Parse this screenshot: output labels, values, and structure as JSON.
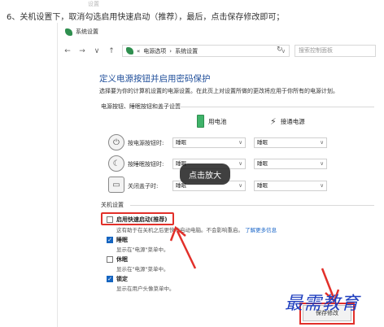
{
  "caption": "6、关机设置下，取消勾选启用快速启动（推荐），最后，点击保存修改即可；",
  "top_crop_text": "设置",
  "window": {
    "title": "系统设置",
    "nav": {
      "back": "←",
      "forward": "→",
      "down": "∨",
      "up": "↑"
    },
    "breadcrumb": [
      "电源选项",
      "系统设置"
    ],
    "breadcrumb_sep": "›",
    "breadcrumb_prefix": "«",
    "refresh": "↻",
    "search_placeholder": "搜索控制面板"
  },
  "heading": "定义电源按钮并启用密码保护",
  "subheading": "选择要为你的计算机设置的电源设置。在此页上对设置所做的更改将应用于你所有的电源计划。",
  "power_section": {
    "label": "电源按钮、睡眠按钮和盖子设置",
    "col_battery": "用电池",
    "col_plugged": "接通电源",
    "rows": [
      {
        "label": "按电源按钮时:",
        "battery": "睡眠",
        "plugged": "睡眠"
      },
      {
        "label": "按睡眠按钮时:",
        "battery": "睡眠",
        "plugged": "睡眠"
      },
      {
        "label": "关闭盖子时:",
        "battery": "睡眠",
        "plugged": "睡眠"
      }
    ]
  },
  "tooltip": "点击放大",
  "shutdown_section": {
    "label": "关机设置",
    "options": [
      {
        "label": "启用快速启动(推荐)",
        "checked": false,
        "desc": "这有助于在关机之后更快地启动电脑。不会影响重启。",
        "link": "了解更多信息"
      },
      {
        "label": "睡眠",
        "checked": true,
        "desc": "显示在\"电源\"菜单中。"
      },
      {
        "label": "休眠",
        "checked": false,
        "desc": "显示在\"电源\"菜单中。"
      },
      {
        "label": "锁定",
        "checked": true,
        "desc": "显示在用户头像菜单中。"
      }
    ]
  },
  "save_button": "保存修改",
  "watermark": "最需教育",
  "colors": {
    "heading": "#1f4e9a",
    "highlight": "#e2302a",
    "checkbox": "#1464c0",
    "watermark": "#1f3fbf"
  }
}
